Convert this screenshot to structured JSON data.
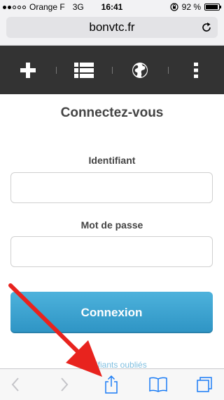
{
  "status_bar": {
    "carrier": "Orange F",
    "network": "3G",
    "time": "16:41",
    "battery_percent": "92 %",
    "battery_level": 0.92,
    "signal_bars_filled": 2,
    "signal_bars_total": 5
  },
  "url_bar": {
    "domain": "bonvtc.fr"
  },
  "site_toolbar": {
    "background": "#333333",
    "icons": [
      "plus-icon",
      "list-icon",
      "globe-icon",
      "more-vertical-icon"
    ]
  },
  "login": {
    "title": "Connectez-vous",
    "username_label": "Identifiant",
    "username_value": "",
    "password_label": "Mot de passe",
    "password_value": "",
    "submit_label": "Connexion",
    "forgot_link": "Identifiants oubliés"
  },
  "bottom_toolbar": {
    "icons": [
      "back-icon",
      "forward-icon",
      "share-icon",
      "bookmarks-icon",
      "tabs-icon"
    ],
    "accent_color": "#1a7cf5"
  },
  "annotation": {
    "arrow_color": "#e8231e",
    "points_to": "share-icon"
  }
}
